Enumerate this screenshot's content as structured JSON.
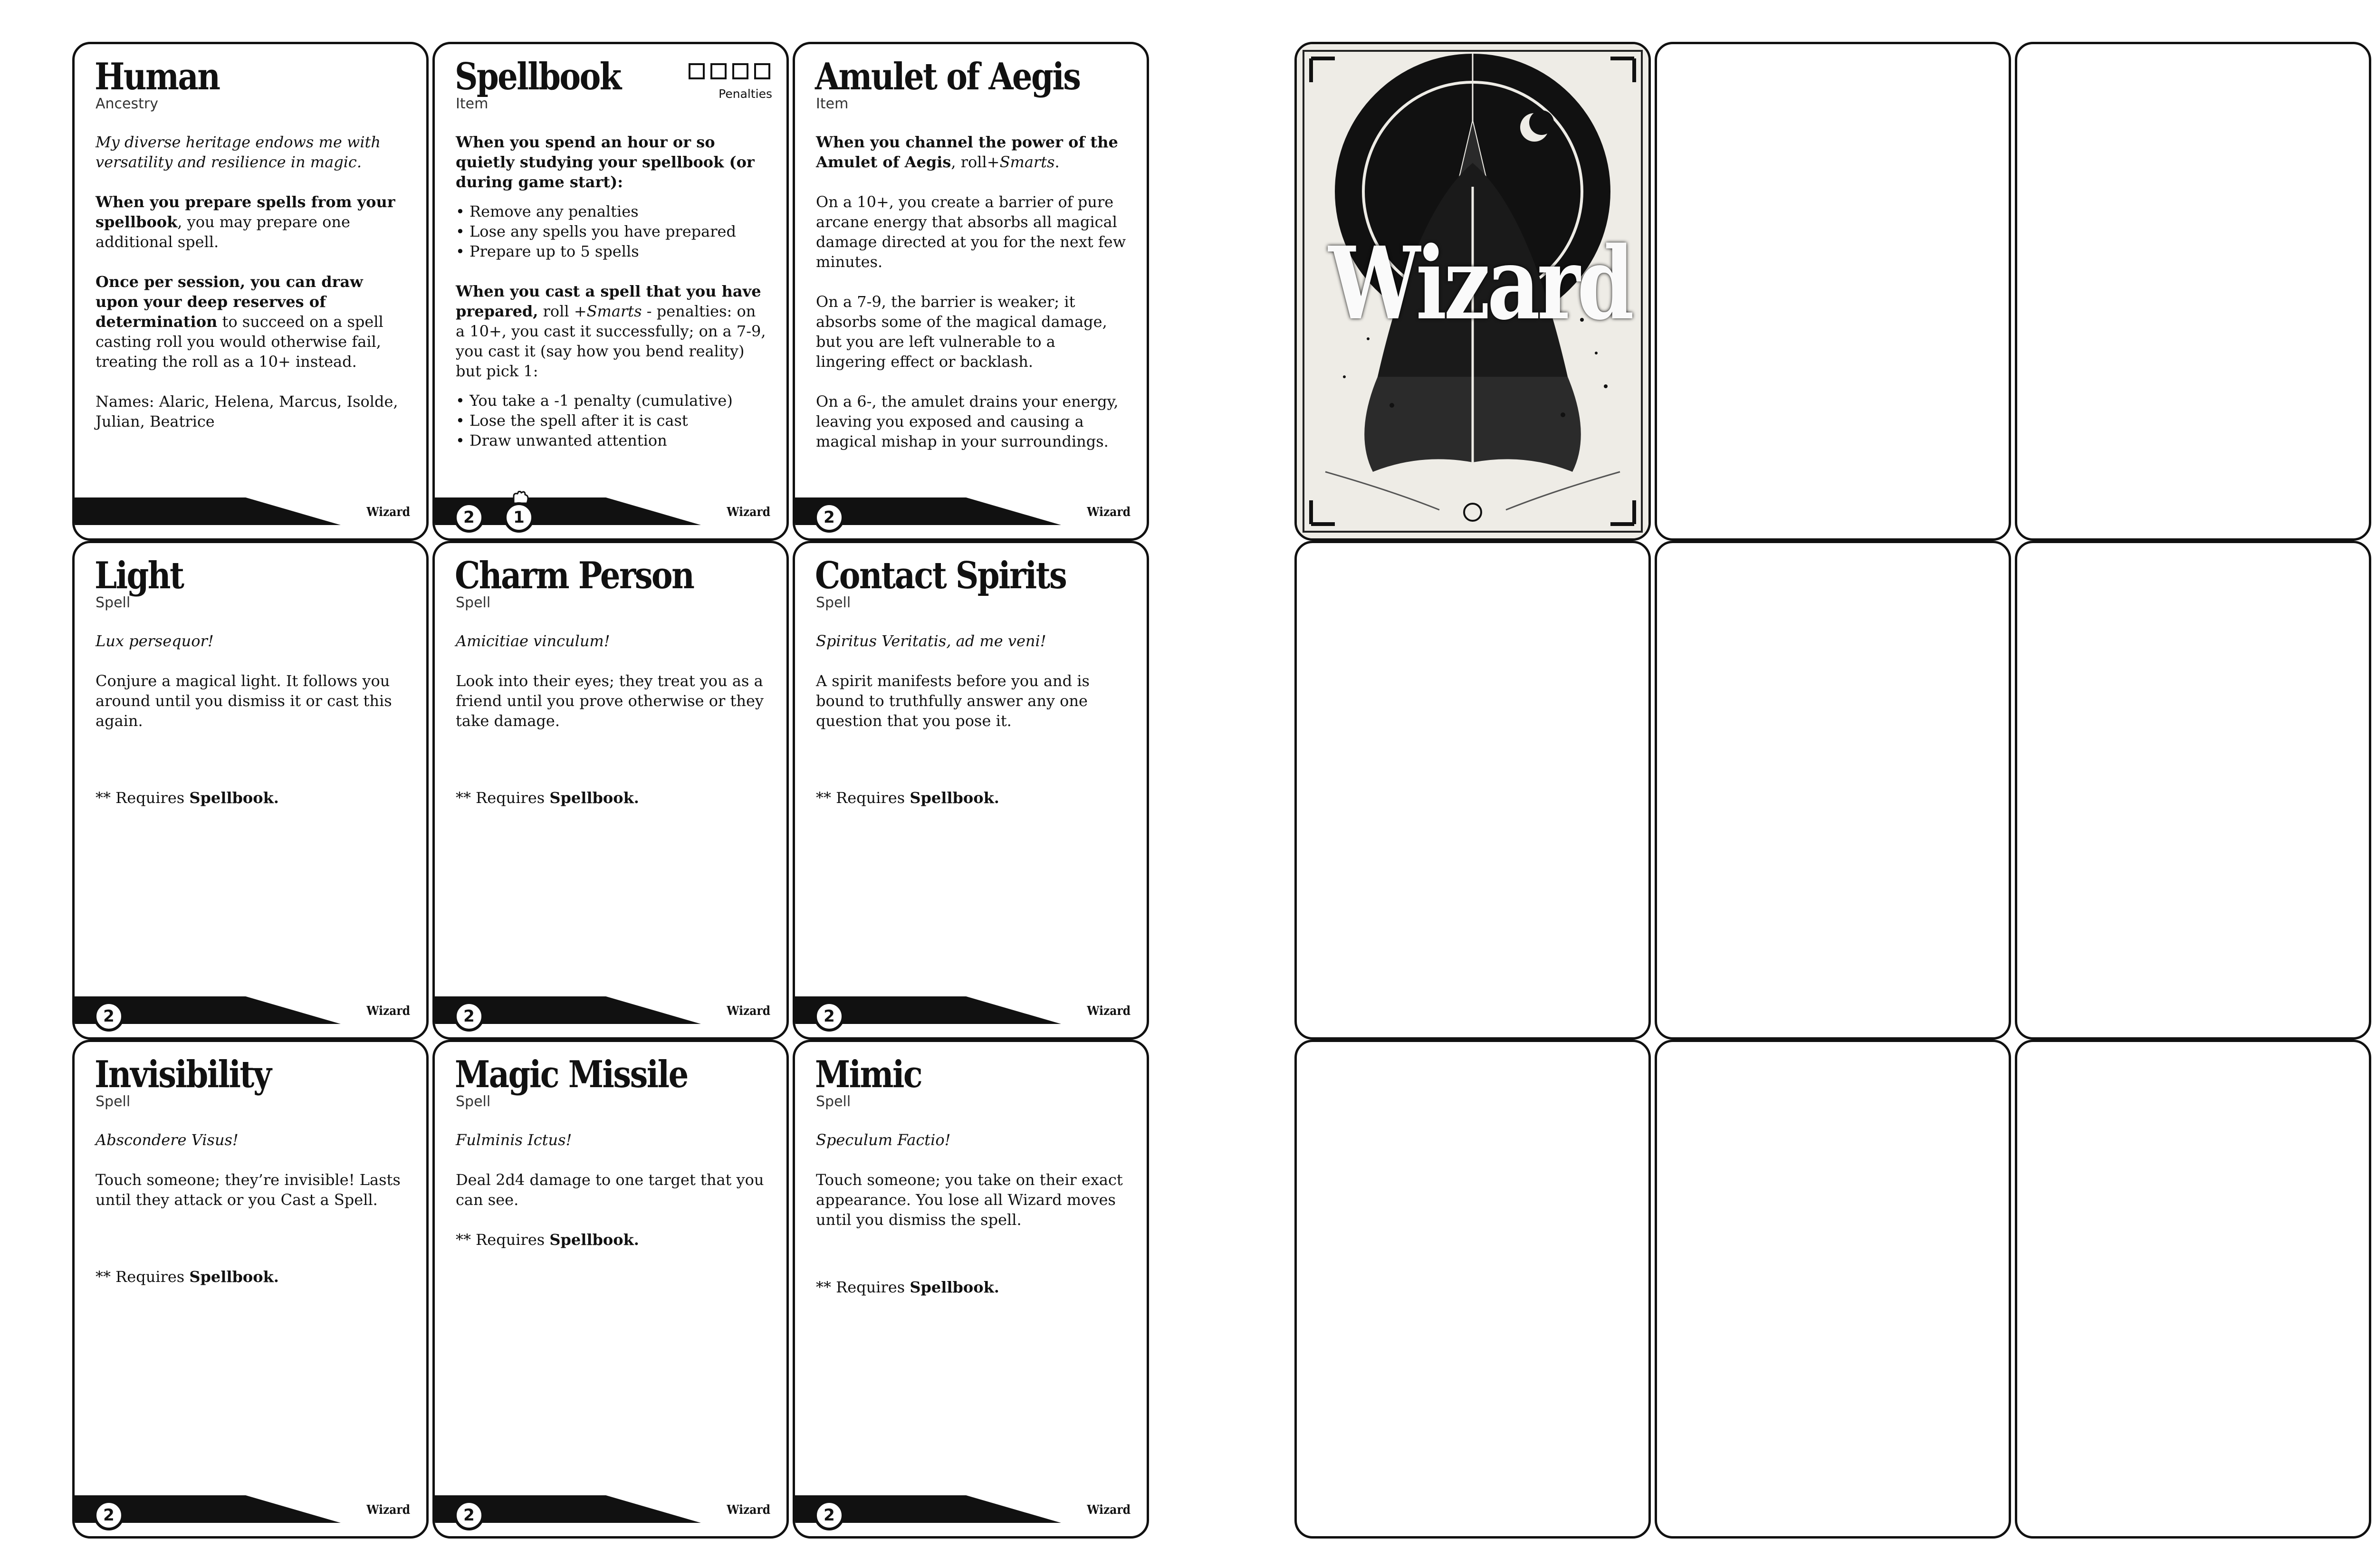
{
  "class_name": "Wizard",
  "cards": {
    "human": {
      "title": "Human",
      "type": "Ancestry",
      "flavor": "My diverse heritage endows me with versatility and resilience in magic.",
      "p1_bold": "When you prepare spells from your spellbook",
      "p1_rest": ", you may prepare one additional spell.",
      "p2_bold": "Once per session, you can draw upon your deep reserves of determination",
      "p2_rest": " to succeed on a spell casting roll you would otherwise fail, treating the roll as a 10+ instead.",
      "names": "Names: Alaric, Helena, Marcus, Isolde, Julian, Beatrice"
    },
    "spellbook": {
      "title": "Spellbook",
      "type": "Item",
      "penalties_label": "Penalties",
      "p1_bold": "When you spend an hour or so quietly studying your spellbook (or during game start):",
      "list1": [
        "Remove any penalties",
        "Lose any spells you have prepared",
        "Prepare up to 5 spells"
      ],
      "p2_bold": "When you cast a spell that you have prepared,",
      "p2_a": " roll +",
      "p2_em": "Smarts",
      "p2_b": " - penalties: on a 10+, you cast it successfully; on a 7-9, you cast it (say how you bend reality) but pick 1:",
      "list2": [
        "You take a -1 penalty (cumulative)",
        "Lose the spell after it is cast",
        "Draw unwanted attention"
      ],
      "cost": "2",
      "cost_secondary": "1"
    },
    "amulet": {
      "title": "Amulet of Aegis",
      "type": "Item",
      "p1_bold": "When you channel the power of the Amulet of Aegis",
      "p1_a": ", roll+",
      "p1_em": "Smarts",
      "p1_b": ".",
      "p2": "On a 10+, you create a barrier of pure arcane energy that absorbs all magical damage directed at you for the next few minutes.",
      "p3": "On a 7-9, the barrier is weaker; it absorbs some of the magical damage, but you are left vulnerable to a lingering effect or backlash.",
      "p4": "On a 6-, the amulet drains your energy, leaving you exposed and causing a magical mishap in your surroundings.",
      "cost": "2"
    },
    "light": {
      "title": "Light",
      "type": "Spell",
      "flavor": "Lux persequor!",
      "desc": "Conjure a magical light. It follows you around until you dismiss it or cast this again.",
      "req": "** Requires ",
      "req_bold": "Spellbook.",
      "cost": "2"
    },
    "charm": {
      "title": "Charm Person",
      "type": "Spell",
      "flavor": "Amicitiae vinculum!",
      "desc": "Look into their eyes; they treat you as a friend until you prove otherwise or they take damage.",
      "req": "** Requires ",
      "req_bold": "Spellbook.",
      "cost": "2"
    },
    "contact": {
      "title": "Contact Spirits",
      "type": "Spell",
      "flavor": "Spiritus Veritatis, ad me veni!",
      "desc": "A spirit manifests before you and is bound to truthfully answer any one question that you pose it.",
      "req": "** Requires ",
      "req_bold": "Spellbook.",
      "cost": "2"
    },
    "invisibility": {
      "title": "Invisibility",
      "type": "Spell",
      "flavor": "Abscondere Visus!",
      "desc": "Touch someone; they’re invisible! Lasts until they attack or you Cast a Spell.",
      "req": "** Requires ",
      "req_bold": "Spellbook.",
      "cost": "2"
    },
    "missile": {
      "title": "Magic Missile",
      "type": "Spell",
      "flavor": "Fulminis Ictus!",
      "desc": "Deal 2d4 damage to one target that you can see.",
      "req": "** Requires ",
      "req_bold": "Spellbook.",
      "cost": "2"
    },
    "mimic": {
      "title": "Mimic",
      "type": "Spell",
      "flavor": "Speculum Factio!",
      "desc": "Touch someone; you take on their exact appearance. You lose all Wizard moves until you dismiss the spell.",
      "req": "** Requires ",
      "req_bold": "Spellbook.",
      "cost": "2"
    },
    "art": {
      "title": "Wizard"
    }
  }
}
